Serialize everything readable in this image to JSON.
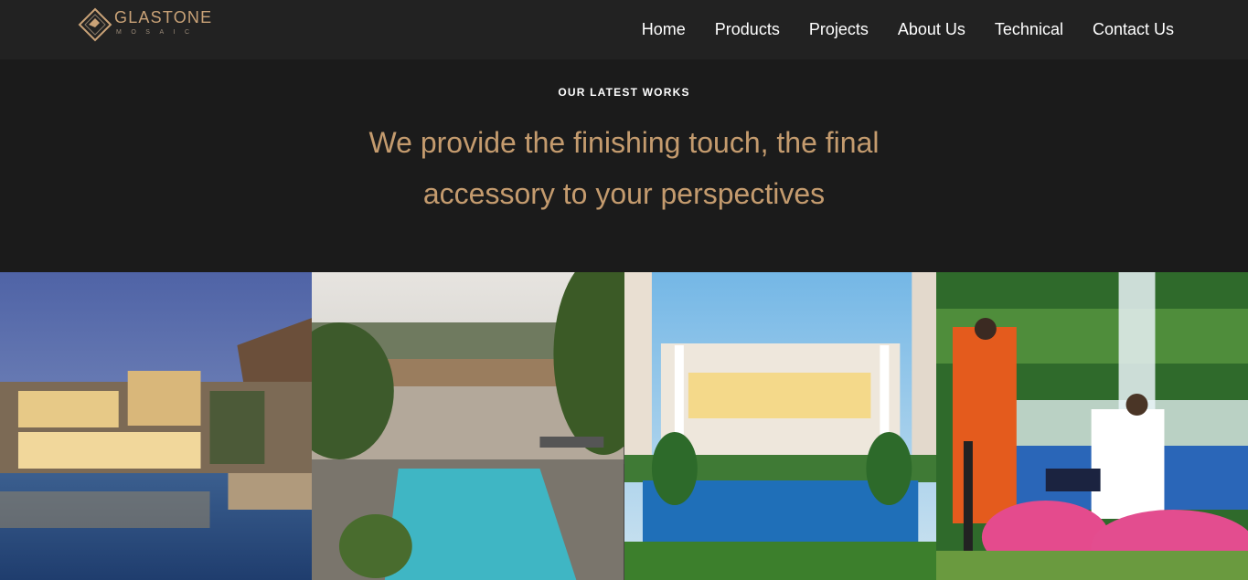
{
  "brand": {
    "name": "GLASTONE",
    "tagline": "MOSAIC",
    "accent": "#c9a277"
  },
  "nav": {
    "items": [
      "Home",
      "Products",
      "Projects",
      "About Us",
      "Technical",
      "Contact Us"
    ]
  },
  "section": {
    "eyebrow": "OUR LATEST WORKS",
    "headline_line1": "We provide the finishing touch, the final",
    "headline_line2": "accessory to your perspectives",
    "headline_color": "#c49b6e"
  },
  "gallery": {
    "images": [
      {
        "name": "villa-pool-dusk"
      },
      {
        "name": "lakeside-infinity-pool"
      },
      {
        "name": "white-building-pool"
      },
      {
        "name": "garden-fountain-couple"
      }
    ]
  }
}
